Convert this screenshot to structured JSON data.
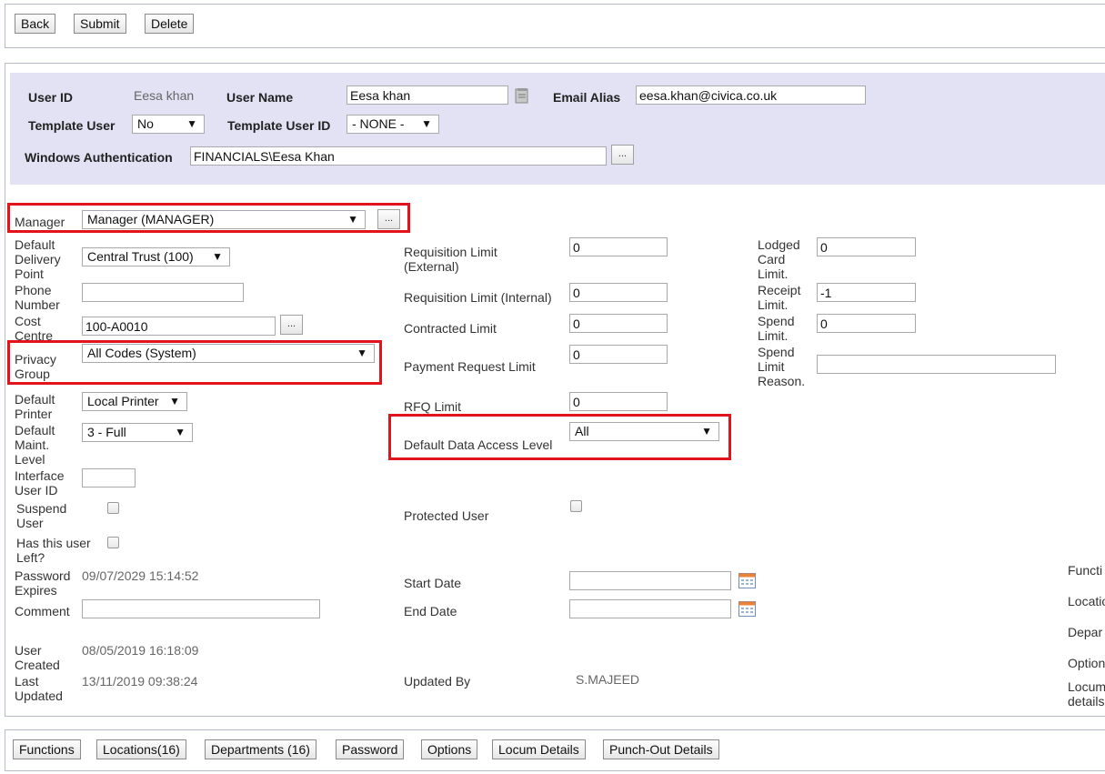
{
  "toolbar": {
    "back": "Back",
    "submit": "Submit",
    "delete": "Delete"
  },
  "header": {
    "user_id_label": "User ID",
    "user_id_value": "Eesa khan",
    "user_name_label": "User Name",
    "user_name_value": "Eesa khan",
    "email_alias_label": "Email Alias",
    "email_alias_value": "eesa.khan@civica.co.uk",
    "template_user_label": "Template User",
    "template_user_value": "No",
    "template_user_id_label": "Template User ID",
    "template_user_id_value": "- NONE -",
    "windows_auth_label": "Windows Authentication",
    "windows_auth_value": "FINANCIALS\\Eesa Khan",
    "ellipsis": "..."
  },
  "left": {
    "manager_label": "Manager",
    "manager_value": "Manager (MANAGER)",
    "ddp_label_1": "Default",
    "ddp_label_2": "Delivery",
    "ddp_label_3": "Point",
    "ddp_value": "Central Trust (100)",
    "phone_label_1": "Phone",
    "phone_label_2": "Number",
    "phone_value": "",
    "cost_label_1": "Cost",
    "cost_label_2": "Centre",
    "cost_value": "100-A0010",
    "privacy_label_1": "Privacy",
    "privacy_label_2": "Group",
    "privacy_value": "All Codes (System)",
    "printer_label_1": "Default",
    "printer_label_2": "Printer",
    "printer_value": "Local Printer",
    "maint_label_1": "Default",
    "maint_label_2": "Maint.",
    "maint_label_3": "Level",
    "maint_value": "3 - Full",
    "interface_label_1": "Interface",
    "interface_label_2": "User ID",
    "interface_value": "",
    "suspend_label_1": "Suspend",
    "suspend_label_2": "User",
    "left_label_1": "Has this user",
    "left_label_2": "Left?",
    "pwexp_label_1": "Password",
    "pwexp_label_2": "Expires",
    "pwexp_value": "09/07/2029 15:14:52",
    "comment_label": "Comment",
    "comment_value": "",
    "created_label_1": "User",
    "created_label_2": "Created",
    "created_value": "08/05/2019 16:18:09",
    "updated_label_1": "Last",
    "updated_label_2": "Updated",
    "updated_value": "13/11/2019 09:38:24"
  },
  "middle": {
    "req_ext_label_1": "Requisition Limit",
    "req_ext_label_2": "(External)",
    "req_ext_value": "0",
    "req_int_label": "Requisition Limit (Internal)",
    "req_int_value": "0",
    "contracted_label": "Contracted Limit",
    "contracted_value": "0",
    "payment_label": "Payment Request Limit",
    "payment_value": "0",
    "rfq_label": "RFQ Limit",
    "rfq_value": "0",
    "dal_label": "Default Data Access Level",
    "dal_value": "All",
    "protected_label": "Protected User",
    "start_label": "Start Date",
    "start_value": "",
    "end_label": "End Date",
    "end_value": "",
    "updated_by_label": "Updated By",
    "updated_by_value": "S.MAJEED"
  },
  "right": {
    "lodged_label_1": "Lodged",
    "lodged_label_2": "Card",
    "lodged_label_3": "Limit.",
    "lodged_value": "0",
    "receipt_label_1": "Receipt",
    "receipt_label_2": "Limit.",
    "receipt_value": "-1",
    "spend_label_1": "Spend",
    "spend_label_2": "Limit.",
    "spend_value": "0",
    "spend_reason_label_1": "Spend",
    "spend_reason_label_2": "Limit",
    "spend_reason_label_3": "Reason.",
    "spend_reason_value": ""
  },
  "edge_links": [
    "Functi",
    "Locatio",
    "Depar",
    "Option",
    "Locum",
    "details"
  ],
  "bottom_tabs": {
    "functions": "Functions",
    "locations": "Locations(16)",
    "departments": "Departments (16)",
    "password": "Password",
    "options": "Options",
    "locum": "Locum Details",
    "punchout": "Punch-Out Details"
  },
  "colors": {
    "header_band": "#e2e2f4",
    "highlight": "#e2131b",
    "border": "#b8bcc8"
  },
  "icons": {
    "user_name_lookup": "address-card-icon",
    "date_picker": "calendar-icon"
  }
}
